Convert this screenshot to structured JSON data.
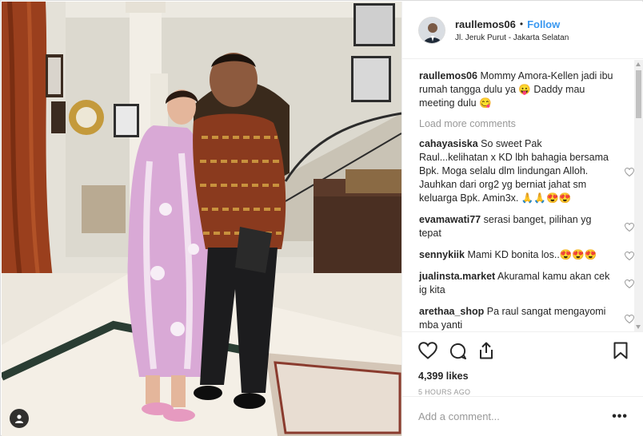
{
  "post": {
    "username": "raullemos06",
    "separator": "•",
    "follow_label": "Follow",
    "location": "Jl. Jeruk Purut - Jakarta Selatan"
  },
  "caption": {
    "username": "raullemos06",
    "text": "Mommy Amora-Kellen jadi ibu rumah tangga dulu ya 😛 Daddy mau meeting dulu 😋"
  },
  "load_more_label": "Load more comments",
  "comments": [
    {
      "username": "cahayasiska",
      "text": "So sweet Pak Raul...kelihatan x KD lbh bahagia bersama Bpk. Moga selalu dlm lindungan Alloh. Jauhkan dari org2 yg berniat jahat sm keluarga Bpk. Amin3x. 🙏🙏😍😍"
    },
    {
      "username": "evamawati77",
      "text": "serasi banget, pilihan yg tepat"
    },
    {
      "username": "sennykiik",
      "text": "Mami KD bonita los..😍😍😍"
    },
    {
      "username": "jualinsta.market",
      "text": "Akuramal kamu akan cek ig kita"
    },
    {
      "username": "arethaa_shop",
      "text": "Pa raul sangat mengayomi mba yanti"
    }
  ],
  "likes": "4,399 likes",
  "timestamp": "5 HOURS AGO",
  "add_comment_placeholder": "Add a comment...",
  "more_options": "•••",
  "icons": [
    "heart-icon",
    "comment-icon",
    "share-icon",
    "bookmark-icon",
    "user-tag-icon"
  ],
  "colors": {
    "follow": "#3897f0",
    "muted": "#999999",
    "text": "#262626",
    "border": "#efefef"
  }
}
